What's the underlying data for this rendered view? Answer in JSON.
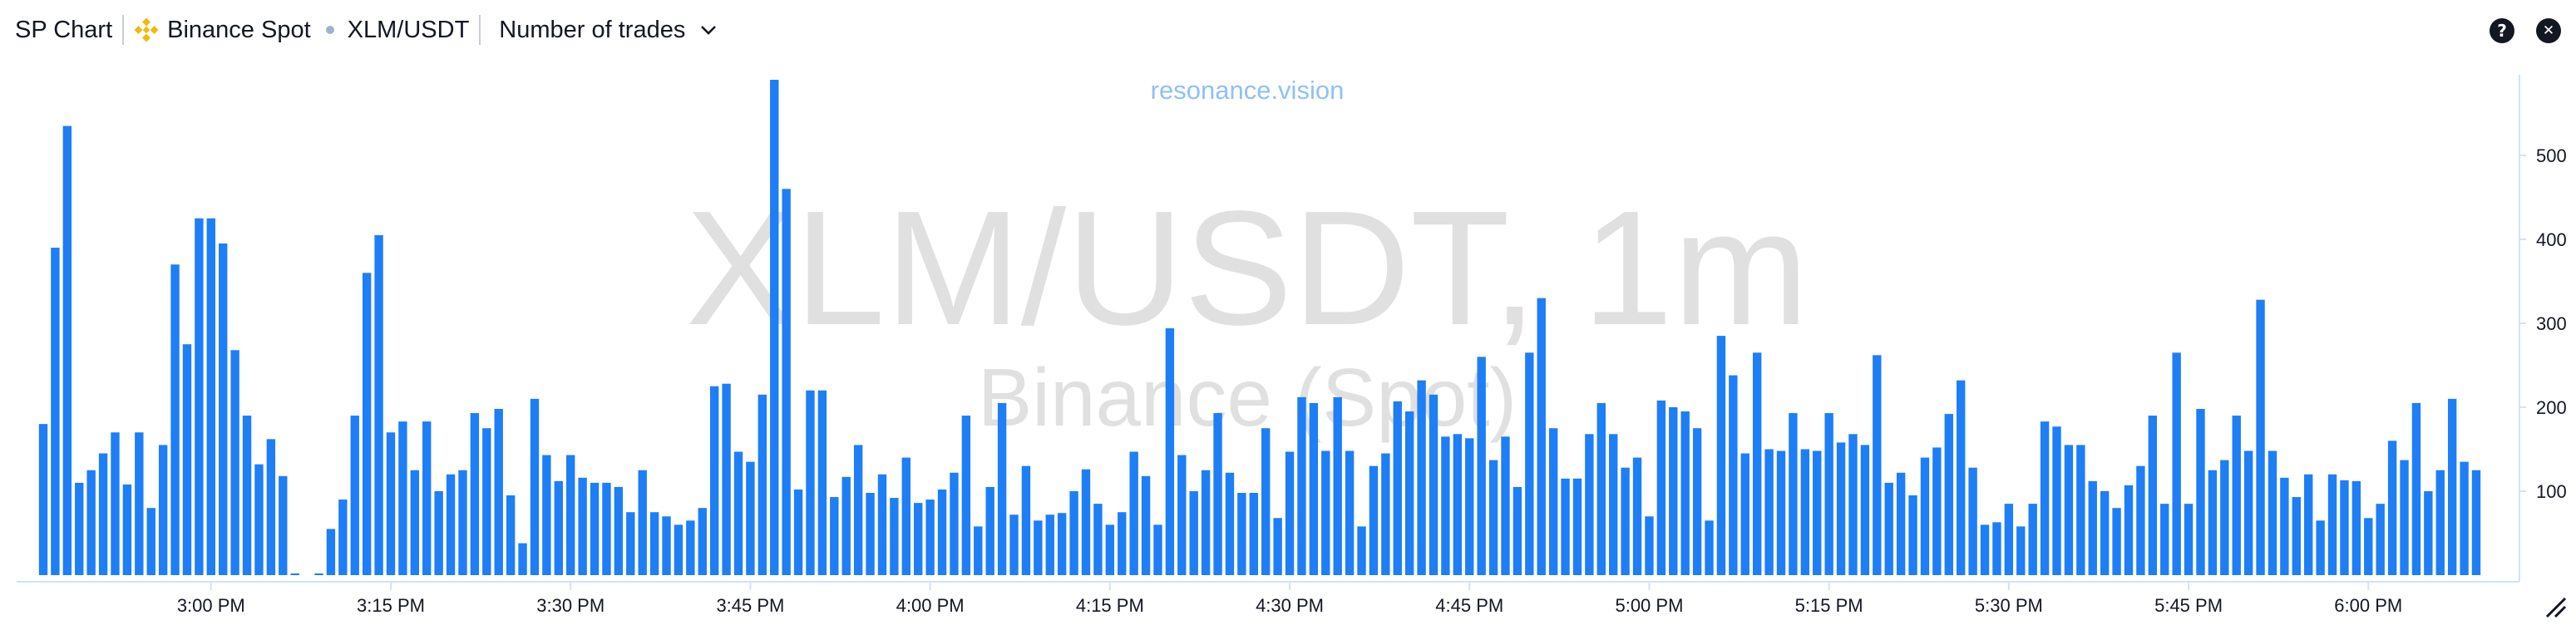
{
  "header": {
    "app_title": "SP Chart",
    "exchange": "Binance Spot",
    "exchange_icon": "binance-diamond-icon",
    "pair": "XLM/USDT",
    "metric": "Number of trades",
    "help_label": "?",
    "close_label": "✕"
  },
  "colors": {
    "bar": "#1e7ef5",
    "watermark": "#e0e0e0",
    "brand": "#8fc0f8",
    "axis": "#cfe3fb",
    "binance": "#f0b90b"
  },
  "chart_data": {
    "type": "bar",
    "title": "XLM/USDT, 1m",
    "subtitle": "Binance (Spot)",
    "brand": "resonance.vision",
    "xlabel": "",
    "ylabel": "",
    "ylim": [
      0,
      590
    ],
    "y_ticks": [
      100,
      200,
      300,
      400,
      500
    ],
    "x_ticks": [
      {
        "label": "3:00 PM",
        "index": 14
      },
      {
        "label": "3:15 PM",
        "index": 29
      },
      {
        "label": "3:30 PM",
        "index": 44
      },
      {
        "label": "3:45 PM",
        "index": 59
      },
      {
        "label": "4:00 PM",
        "index": 74
      },
      {
        "label": "4:15 PM",
        "index": 89
      },
      {
        "label": "4:30 PM",
        "index": 104
      },
      {
        "label": "4:45 PM",
        "index": 119
      },
      {
        "label": "5:00 PM",
        "index": 134
      },
      {
        "label": "5:15 PM",
        "index": 149
      },
      {
        "label": "5:30 PM",
        "index": 164
      },
      {
        "label": "5:45 PM",
        "index": 179
      },
      {
        "label": "6:00 PM",
        "index": 194
      }
    ],
    "values": [
      180,
      390,
      535,
      110,
      125,
      145,
      170,
      108,
      170,
      80,
      155,
      370,
      275,
      425,
      425,
      395,
      268,
      190,
      132,
      162,
      118,
      2,
      0,
      2,
      55,
      90,
      190,
      360,
      405,
      170,
      183,
      125,
      183,
      100,
      120,
      125,
      193,
      175,
      198,
      95,
      38,
      210,
      143,
      112,
      143,
      116,
      110,
      110,
      105,
      75,
      125,
      75,
      70,
      60,
      65,
      80,
      225,
      228,
      147,
      135,
      215,
      590,
      460,
      102,
      220,
      220,
      93,
      117,
      155,
      98,
      120,
      92,
      140,
      86,
      90,
      102,
      122,
      190,
      58,
      105,
      205,
      72,
      130,
      65,
      72,
      74,
      100,
      126,
      85,
      60,
      75,
      147,
      118,
      60,
      294,
      143,
      100,
      125,
      193,
      122,
      98,
      98,
      175,
      68,
      147,
      212,
      205,
      148,
      212,
      148,
      58,
      130,
      145,
      207,
      195,
      232,
      215,
      165,
      168,
      163,
      260,
      137,
      165,
      105,
      265,
      330,
      175,
      115,
      115,
      168,
      205,
      168,
      128,
      140,
      70,
      208,
      200,
      195,
      175,
      65,
      285,
      238,
      145,
      265,
      150,
      148,
      193,
      150,
      148,
      193,
      158,
      168,
      155,
      262,
      110,
      122,
      95,
      140,
      152,
      192,
      232,
      128,
      60,
      63,
      85,
      58,
      85,
      183,
      177,
      155,
      155,
      112,
      100,
      80,
      107,
      130,
      190,
      85,
      265,
      85,
      198,
      125,
      137,
      190,
      148,
      328,
      148,
      116,
      93,
      120,
      65,
      120,
      113,
      112,
      68,
      85,
      160,
      137,
      205,
      100,
      125,
      210,
      135,
      125
    ]
  }
}
